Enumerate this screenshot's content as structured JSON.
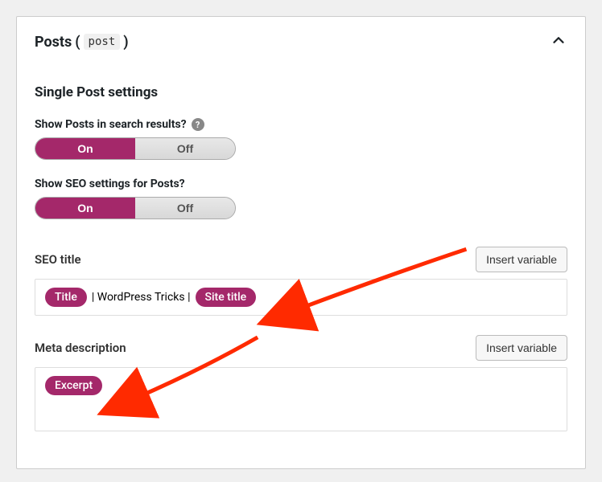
{
  "panel": {
    "title_text": "Posts",
    "slug": "post"
  },
  "section_title": "Single Post settings",
  "toggles": {
    "search": {
      "label": "Show Posts in search results?",
      "on": "On",
      "off": "Off",
      "has_help": true
    },
    "seo": {
      "label": "Show SEO settings for Posts?",
      "on": "On",
      "off": "Off",
      "has_help": false
    }
  },
  "seo_title": {
    "label": "SEO title",
    "insert_btn": "Insert variable",
    "tokens": {
      "title_pill": "Title",
      "literal": "| WordPress Tricks |",
      "site_pill": "Site title"
    }
  },
  "meta_desc": {
    "label": "Meta description",
    "insert_btn": "Insert variable",
    "tokens": {
      "excerpt_pill": "Excerpt"
    }
  }
}
